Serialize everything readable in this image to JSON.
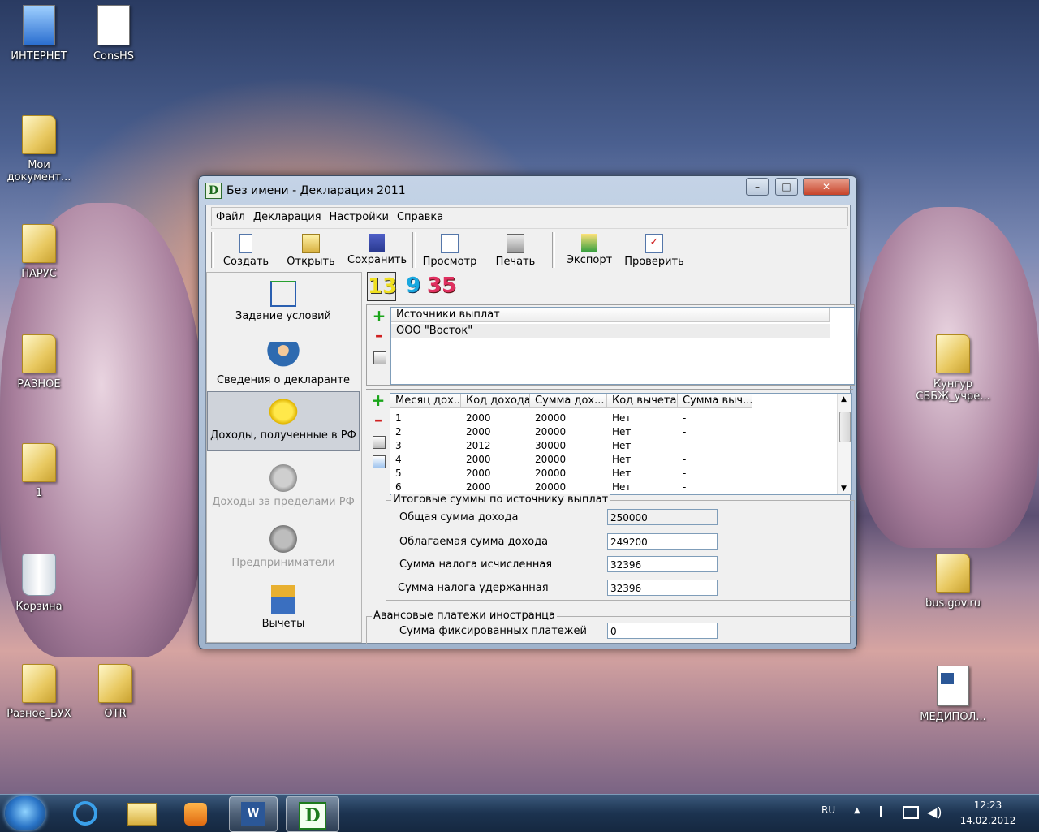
{
  "desktop": {
    "icons": [
      {
        "label": "ИНТЕРНЕТ"
      },
      {
        "label": "ConsHS"
      },
      {
        "label": "Мои документ..."
      },
      {
        "label": "ПАРУС"
      },
      {
        "label": "РАЗНОЕ"
      },
      {
        "label": "1"
      },
      {
        "label": "Корзина"
      },
      {
        "label": "Разное_БУХ"
      },
      {
        "label": "OTR"
      },
      {
        "label": "Кунгур СББЖ_учре..."
      },
      {
        "label": "bus.gov.ru"
      },
      {
        "label": "МЕДИПОЛ..."
      }
    ]
  },
  "window": {
    "title": "Без имени - Декларация 2011",
    "menu": [
      "Файл",
      "Декларация",
      "Настройки",
      "Справка"
    ],
    "toolbar": [
      "Создать",
      "Открыть",
      "Сохранить",
      "Просмотр",
      "Печать",
      "Экспорт",
      "Проверить"
    ],
    "nav": [
      {
        "label": "Задание условий",
        "icon": "tree-icon"
      },
      {
        "label": "Сведения о декларанте",
        "icon": "person-icon"
      },
      {
        "label": "Доходы, полученные в РФ",
        "icon": "coins-icon"
      },
      {
        "label": "Доходы за пределами РФ",
        "icon": "money-bag-icon"
      },
      {
        "label": "Предприниматели",
        "icon": "businessmen-icon"
      },
      {
        "label": "Вычеты",
        "icon": "calculator-icon"
      }
    ],
    "rate_tabs": [
      "13",
      "9",
      "35"
    ],
    "sources": {
      "header": "Источники выплат",
      "rows": [
        "ООО \"Восток\""
      ]
    },
    "months": {
      "headers": [
        "Месяц дох...",
        "Код дохода",
        "Сумма дох...",
        "Код вычета",
        "Сумма выч..."
      ],
      "rows": [
        [
          "1",
          "2000",
          "20000",
          "Нет",
          "-"
        ],
        [
          "2",
          "2000",
          "20000",
          "Нет",
          "-"
        ],
        [
          "3",
          "2012",
          "30000",
          "Нет",
          "-"
        ],
        [
          "4",
          "2000",
          "20000",
          "Нет",
          "-"
        ],
        [
          "5",
          "2000",
          "20000",
          "Нет",
          "-"
        ],
        [
          "6",
          "2000",
          "20000",
          "Нет",
          "-"
        ]
      ]
    },
    "totals": {
      "group_label": "Итоговые суммы по источнику выплат",
      "total_income_label": "Общая сумма дохода",
      "total_income": "250000",
      "taxable_income_label": "Облагаемая сумма дохода",
      "taxable_income": "249200",
      "tax_calc_label": "Сумма налога исчисленная",
      "tax_calc": "32396",
      "tax_withheld_label": "Сумма налога удержанная",
      "tax_withheld": "32396"
    },
    "advance": {
      "group_label": "Авансовые платежи иностранца",
      "fixed_label": "Сумма фиксированных платежей",
      "fixed_value": "0"
    }
  },
  "taskbar": {
    "lang": "RU",
    "time": "12:23",
    "date": "14.02.2012"
  }
}
